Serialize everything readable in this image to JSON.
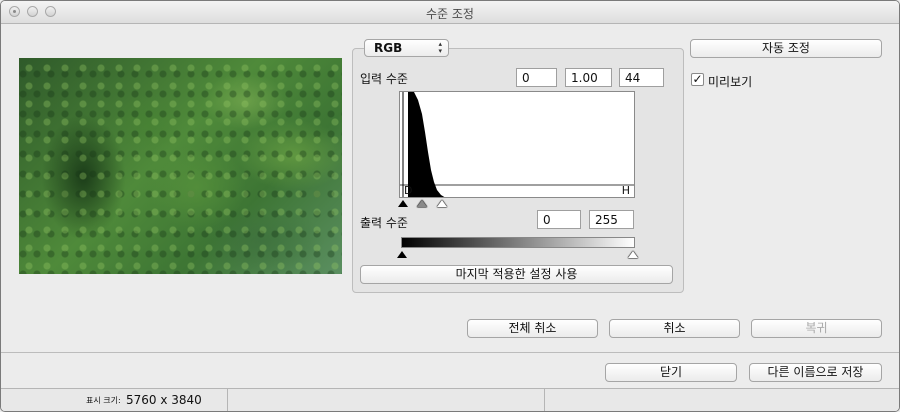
{
  "window": {
    "title": "수준 조정"
  },
  "preview": {
    "image_desc": "forest-photo"
  },
  "channel": {
    "selected": "RGB",
    "arrows": "▴▾"
  },
  "input": {
    "label": "입력 수준",
    "black": "0",
    "gamma": "1.00",
    "white": "44",
    "marker_low": "D",
    "marker_high": "H"
  },
  "output": {
    "label": "출력 수준",
    "black": "0",
    "white": "255"
  },
  "buttons": {
    "auto": "자동 조정",
    "use_last": "마지막 적용한 설정 사용",
    "cancel_all": "전체 취소",
    "cancel": "취소",
    "restore": "복귀",
    "close": "닫기",
    "save_as": "다른 이름으로 저장"
  },
  "preview_toggle": {
    "label": "미리보기",
    "checked": true,
    "mark": "✓"
  },
  "status": {
    "size_label": "표시 크기:",
    "size_value": "5760 x 3840"
  }
}
